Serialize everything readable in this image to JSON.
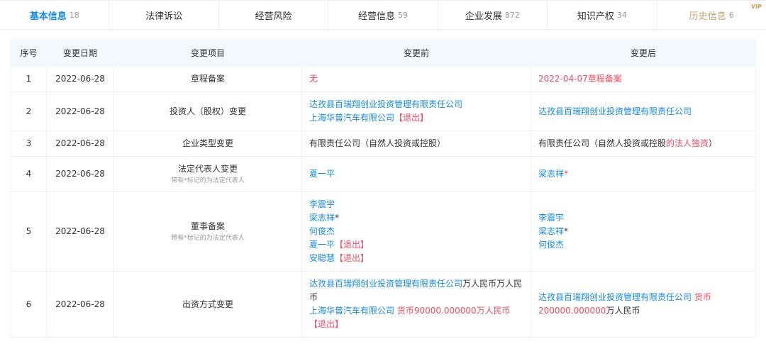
{
  "tabs": [
    {
      "label": "基本信息",
      "count": "18",
      "active": true
    },
    {
      "label": "法律诉讼",
      "count": ""
    },
    {
      "label": "经营风险",
      "count": ""
    },
    {
      "label": "经营信息",
      "count": "59"
    },
    {
      "label": "企业发展",
      "count": "872"
    },
    {
      "label": "知识产权",
      "count": "34"
    },
    {
      "label": "历史信息",
      "count": "6",
      "vip": "VIP"
    }
  ],
  "table": {
    "headers": [
      "序号",
      "变更日期",
      "变更项目",
      "变更前",
      "变更后"
    ],
    "rows": [
      {
        "no": "1",
        "date": "2022-06-28",
        "item": "章程备案",
        "note": "",
        "before": [
          [
            {
              "t": "无",
              "c": "red"
            }
          ]
        ],
        "after": [
          [
            {
              "t": "2022-04-07章程备案",
              "c": "red"
            }
          ]
        ]
      },
      {
        "no": "2",
        "date": "2022-06-28",
        "item": "投资人（股权）变更",
        "note": "",
        "before": [
          [
            {
              "t": "达孜县百瑞翔创业投资管理有限责任公司",
              "c": "blue"
            }
          ],
          [
            {
              "t": "上海华普汽车有限公司",
              "c": "blue"
            },
            {
              "t": "【退出】",
              "c": "red"
            }
          ]
        ],
        "after": [
          [
            {
              "t": "达孜县百瑞翔创业投资管理有限责任公司",
              "c": "blue"
            }
          ]
        ]
      },
      {
        "no": "3",
        "date": "2022-06-28",
        "item": "企业类型变更",
        "note": "",
        "before": [
          [
            {
              "t": "有限责任公司（自然人投资或控股）",
              "c": "dark"
            }
          ]
        ],
        "after": [
          [
            {
              "t": "有限责任公司（自然人投资或控股",
              "c": "dark"
            },
            {
              "t": "的法人独资",
              "c": "red"
            },
            {
              "t": "）",
              "c": "dark"
            }
          ]
        ]
      },
      {
        "no": "4",
        "date": "2022-06-28",
        "item": "法定代表人变更",
        "note": "带有*标记的为法定代表人",
        "before": [
          [
            {
              "t": "夏一平",
              "c": "blue"
            }
          ]
        ],
        "after": [
          [
            {
              "t": "梁志祥",
              "c": "blue"
            },
            {
              "t": "*",
              "c": "red"
            }
          ]
        ]
      },
      {
        "no": "5",
        "date": "2022-06-28",
        "item": "董事备案",
        "note": "带有*标记的为法定代表人",
        "before": [
          [
            {
              "t": "李震宇",
              "c": "blue"
            }
          ],
          [
            {
              "t": "梁志祥",
              "c": "blue"
            },
            {
              "t": "*",
              "c": "dark"
            }
          ],
          [
            {
              "t": "何俊杰",
              "c": "blue"
            }
          ],
          [
            {
              "t": "夏一平",
              "c": "blue"
            },
            {
              "t": "【退出】",
              "c": "red"
            }
          ],
          [
            {
              "t": "安聪慧",
              "c": "blue"
            },
            {
              "t": "【退出】",
              "c": "red"
            }
          ]
        ],
        "after": [
          [
            {
              "t": "李震宇",
              "c": "blue"
            }
          ],
          [
            {
              "t": "梁志祥",
              "c": "blue"
            },
            {
              "t": "*",
              "c": "dark"
            }
          ],
          [
            {
              "t": "何俊杰",
              "c": "blue"
            }
          ]
        ]
      },
      {
        "no": "6",
        "date": "2022-06-28",
        "item": "出资方式变更",
        "note": "",
        "before": [
          [
            {
              "t": "达孜县百瑞翔创业投资管理有限责任公司",
              "c": "blue"
            },
            {
              "t": "万人民币万人民币",
              "c": "dark"
            }
          ],
          [
            {
              "t": "上海华普汽车有限公司",
              "c": "blue"
            },
            {
              "t": " 货币90000.000000万人民币",
              "c": "red"
            },
            {
              "t": "【退出】",
              "c": "red"
            }
          ]
        ],
        "after": [
          [
            {
              "t": "达孜县百瑞翔创业投资管理有限责任公司",
              "c": "blue"
            },
            {
              "t": " 货币200000.000000",
              "c": "red"
            },
            {
              "t": "万人民币",
              "c": "dark"
            }
          ]
        ]
      }
    ]
  }
}
